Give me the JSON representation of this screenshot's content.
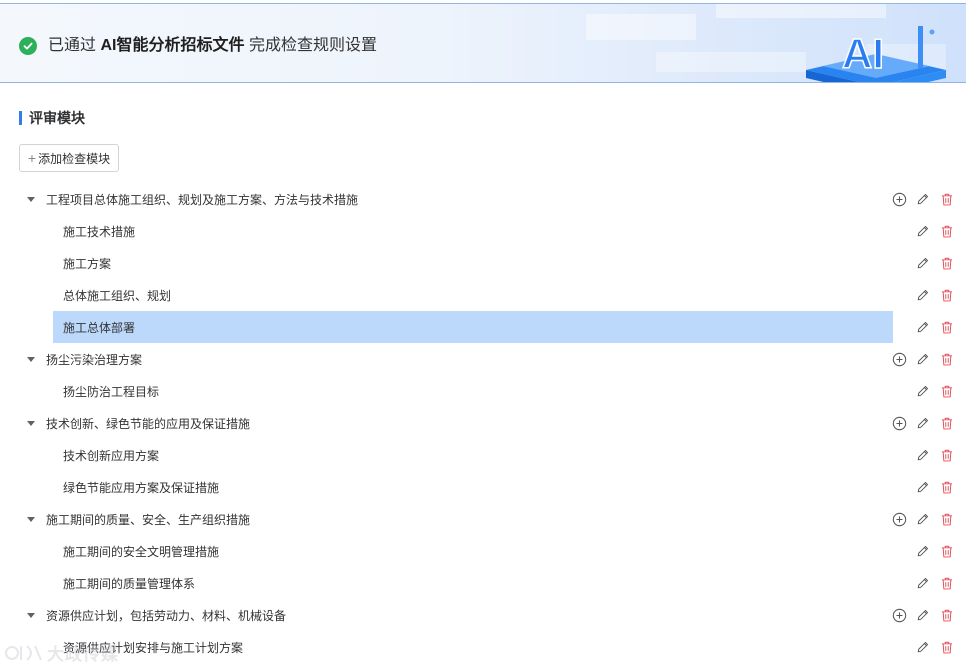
{
  "banner": {
    "prefix": "已通过",
    "highlight": "AI智能分析招标文件",
    "suffix": "完成检查规则设置",
    "art_text": "AI"
  },
  "section": {
    "title": "评审模块"
  },
  "add_module_button": {
    "plus": "+",
    "label": "添加检查模块"
  },
  "tree": [
    {
      "label": "工程项目总体施工组织、规划及施工方案、方法与技术措施",
      "children": [
        {
          "label": "施工技术措施"
        },
        {
          "label": "施工方案"
        },
        {
          "label": "总体施工组织、规划"
        },
        {
          "label": "施工总体部署",
          "selected": true
        }
      ]
    },
    {
      "label": "扬尘污染治理方案",
      "children": [
        {
          "label": "扬尘防治工程目标"
        }
      ]
    },
    {
      "label": "技术创新、绿色节能的应用及保证措施",
      "children": [
        {
          "label": "技术创新应用方案"
        },
        {
          "label": "绿色节能应用方案及保证措施"
        }
      ]
    },
    {
      "label": "施工期间的质量、安全、生产组织措施",
      "children": [
        {
          "label": "施工期间的安全文明管理措施"
        },
        {
          "label": "施工期间的质量管理体系"
        }
      ]
    },
    {
      "label": "资源供应计划，包括劳动力、材料、机械设备",
      "children": [
        {
          "label": "资源供应计划安排与施工计划方案"
        }
      ]
    }
  ],
  "colors": {
    "accent": "#2f7fe8",
    "selected": "#bcd8fb",
    "delete": "#e34d59",
    "success": "#2db05a"
  },
  "watermark": {
    "text": "大政传媒"
  }
}
